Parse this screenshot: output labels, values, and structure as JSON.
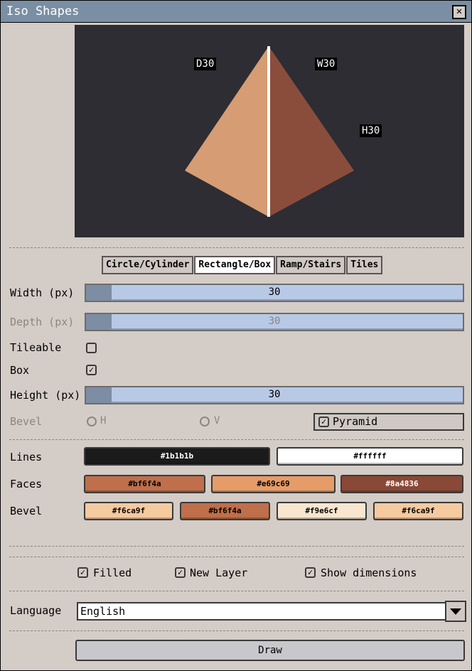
{
  "window": {
    "title": "Iso Shapes",
    "close_label": "✕"
  },
  "preview": {
    "labels": {
      "depth": "D30",
      "width": "W30",
      "height": "H30"
    },
    "colors": {
      "left_face": "#d69c73",
      "right_face": "#8a4d3b",
      "background": "#2d2d33",
      "edge": "#ffffff"
    }
  },
  "tabs": [
    {
      "label": "Circle/Cylinder",
      "active": false
    },
    {
      "label": "Rectangle/Box",
      "active": true
    },
    {
      "label": "Ramp/Stairs",
      "active": false
    },
    {
      "label": "Tiles",
      "active": false
    }
  ],
  "width": {
    "label": "Width (px)",
    "value": "30",
    "fraction": 0.07
  },
  "depth": {
    "label": "Depth (px)",
    "value": "30",
    "fraction": 0.07,
    "disabled": true
  },
  "tileable": {
    "label": "Tileable",
    "checked": false
  },
  "box": {
    "label": "Box",
    "checked": true
  },
  "height": {
    "label": "Height (px)",
    "value": "30",
    "fraction": 0.07
  },
  "bevel": {
    "label": "Bevel",
    "h_label": "H",
    "v_label": "V",
    "pyramid_label": "Pyramid",
    "pyramid_checked": true
  },
  "lines": {
    "label": "Lines",
    "colors": [
      {
        "hex": "#1b1b1b",
        "text": "#ffffff"
      },
      {
        "hex": "#ffffff",
        "text": "#000000"
      }
    ]
  },
  "faces": {
    "label": "Faces",
    "colors": [
      {
        "hex": "#bf6f4a",
        "text": "#000000"
      },
      {
        "hex": "#e69c69",
        "text": "#000000"
      },
      {
        "hex": "#8a4836",
        "text": "#ffffff"
      }
    ]
  },
  "bevel_colors": {
    "label": "Bevel",
    "colors": [
      {
        "hex": "#f6ca9f",
        "text": "#000000"
      },
      {
        "hex": "#bf6f4a",
        "text": "#000000"
      },
      {
        "hex": "#f9e6cf",
        "text": "#000000"
      },
      {
        "hex": "#f6ca9f",
        "text": "#000000"
      }
    ]
  },
  "options": {
    "filled": "Filled",
    "new_layer": "New Layer",
    "show_dimensions": "Show dimensions"
  },
  "language": {
    "label": "Language",
    "value": "English"
  },
  "draw": {
    "label": "Draw"
  }
}
